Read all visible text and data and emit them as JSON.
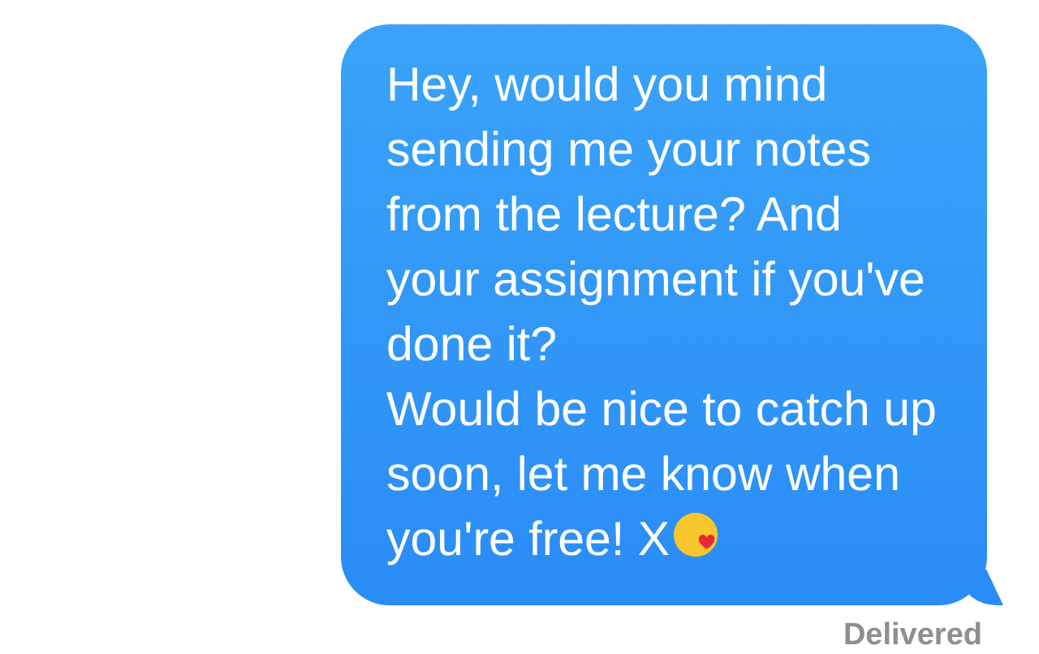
{
  "message": {
    "paragraphs": [
      "Hey, would you mind sending me your notes from the lecture? And your assignment if you've done it?",
      "Would be nice to catch up soon, let me know when you're free! X"
    ],
    "trailing_emoji": {
      "kind": "kiss"
    }
  },
  "status": "Delivered"
}
